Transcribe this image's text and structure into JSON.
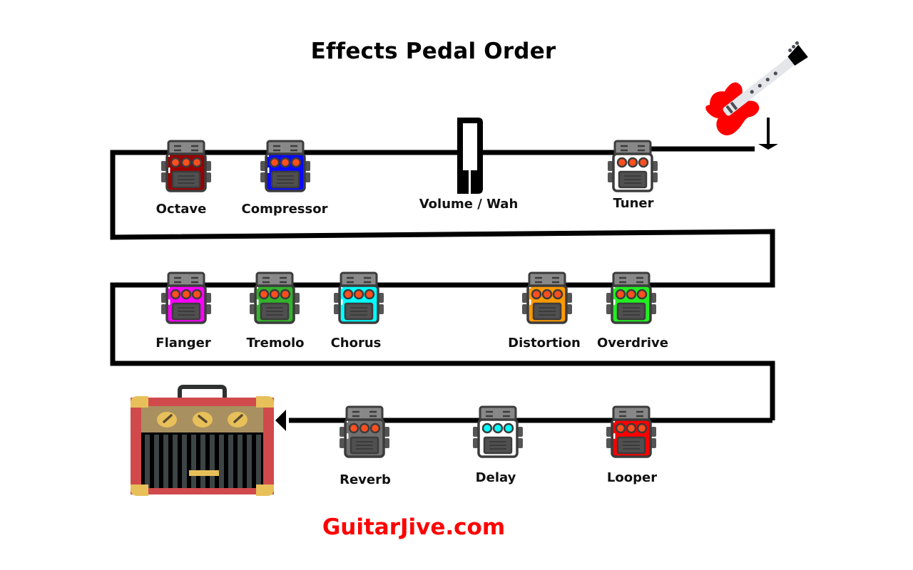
{
  "title": "Effects Pedal Order",
  "credit": "GuitarJive.com",
  "colors": {
    "cable": "#000000",
    "knob": "#ff4f1f",
    "pedal_outline": "#3c3c3c",
    "footswitch": "#505050",
    "credit": "#ff0000",
    "guitar_body": "#ff0000",
    "amp_frame": "#d04a4c",
    "amp_corners": "#e8c05a",
    "amp_panel": "#a89060"
  },
  "signal_flow": {
    "start": "guitar",
    "end": "amplifier",
    "direction_rows": [
      "right-to-left",
      "left-to-right",
      "right-to-left",
      "left-to-right",
      "right-to-left"
    ]
  },
  "pedals": [
    {
      "order": 1,
      "name": "Tuner",
      "color": "#ffffff",
      "knob_color": "#ff4f1f",
      "type": "stompbox"
    },
    {
      "order": 2,
      "name": "Volume / Wah",
      "color": "#000000",
      "type": "expression"
    },
    {
      "order": 3,
      "name": "Compressor",
      "color": "#0a0aff",
      "knob_color": "#ff4f1f",
      "type": "stompbox"
    },
    {
      "order": 4,
      "name": "Octave",
      "color": "#990000",
      "knob_color": "#ff4f1f",
      "type": "stompbox"
    },
    {
      "order": 5,
      "name": "Flanger",
      "color": "#ff00ff",
      "knob_color": "#ff4f1f",
      "type": "stompbox"
    },
    {
      "order": 6,
      "name": "Tremolo",
      "color": "#33b22b",
      "knob_color": "#ff4f1f",
      "type": "stompbox"
    },
    {
      "order": 7,
      "name": "Chorus",
      "color": "#00ffff",
      "knob_color": "#ff4f1f",
      "type": "stompbox"
    },
    {
      "order": 8,
      "name": "Distortion",
      "color": "#ff9900",
      "knob_color": "#ff4f1f",
      "type": "stompbox"
    },
    {
      "order": 9,
      "name": "Overdrive",
      "color": "#22ee22",
      "knob_color": "#ff4f1f",
      "type": "stompbox"
    },
    {
      "order": 10,
      "name": "Looper",
      "color": "#ff0000",
      "knob_color": "#ff4f1f",
      "type": "stompbox"
    },
    {
      "order": 11,
      "name": "Delay",
      "color": "#ffffff",
      "knob_color": "#00ffff",
      "type": "stompbox"
    },
    {
      "order": 12,
      "name": "Reverb",
      "color": "#707070",
      "knob_color": "#ff4f1f",
      "type": "stompbox"
    }
  ],
  "icons": {
    "source": "guitar-icon",
    "destination": "amplifier-icon"
  }
}
